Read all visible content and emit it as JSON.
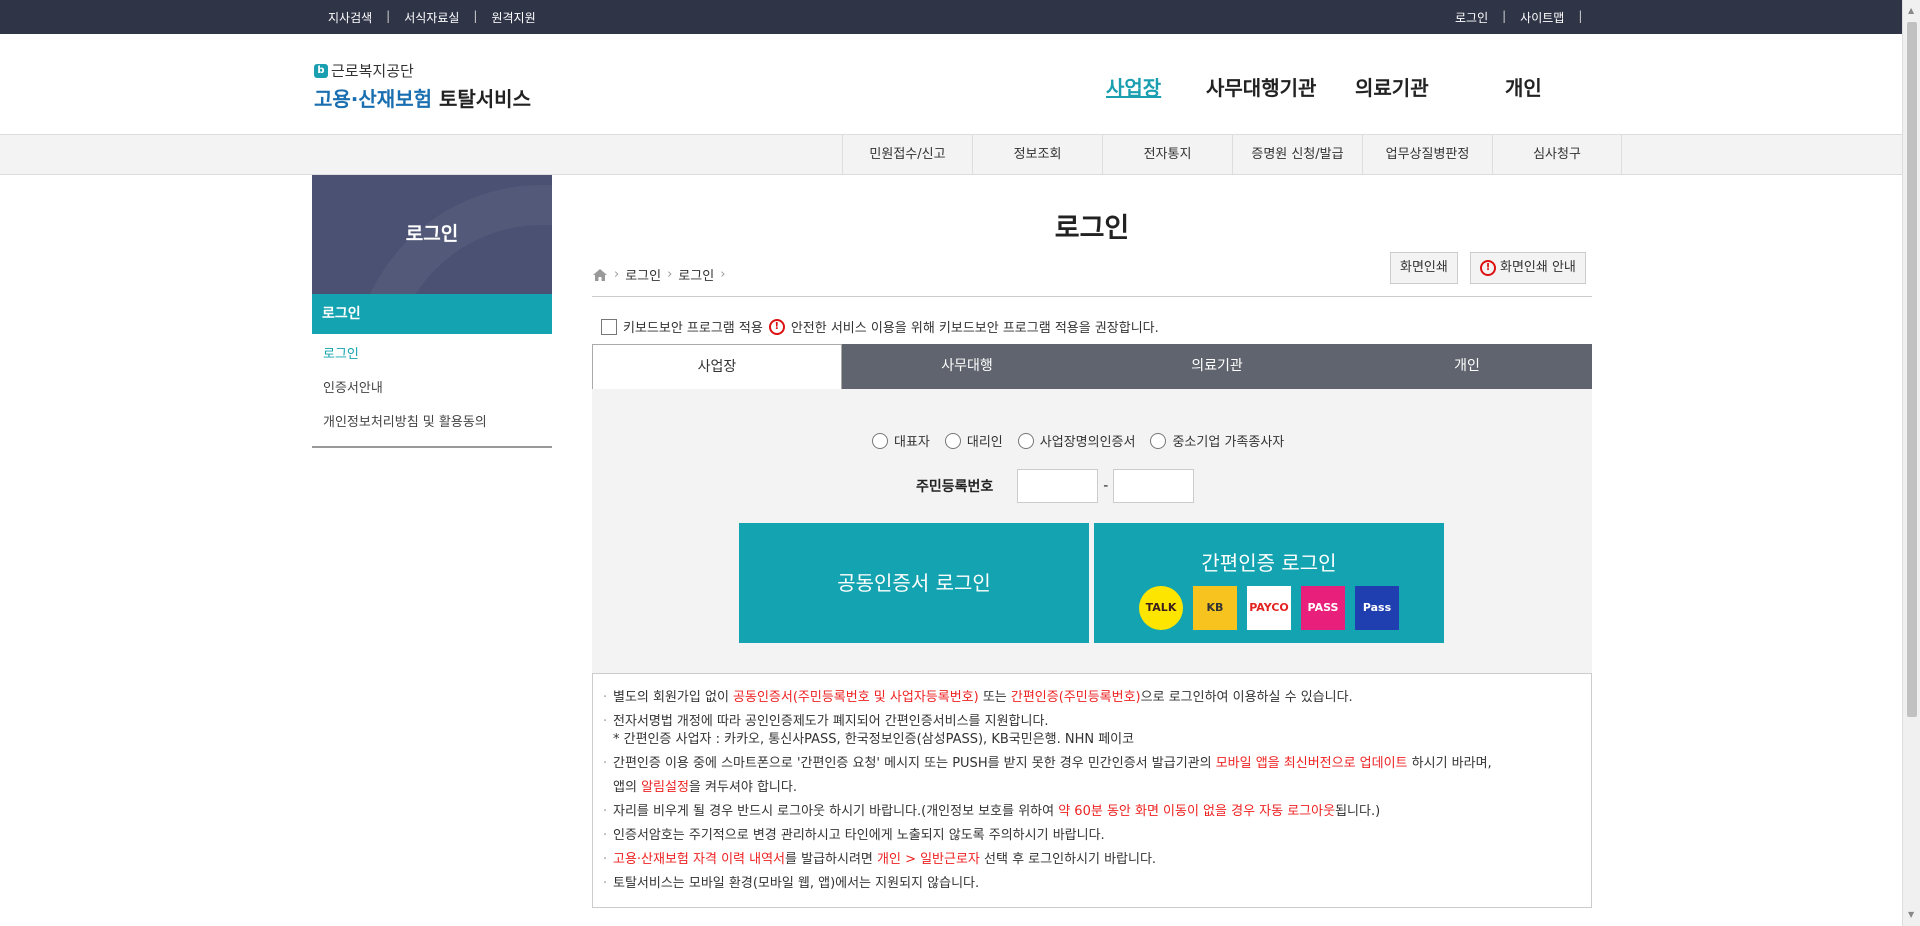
{
  "topbar": {
    "left": [
      "지사검색",
      "서식자료실",
      "원격지원"
    ],
    "right": [
      "로그인",
      "사이트맵"
    ],
    "sep": "|"
  },
  "logo": {
    "agency": "근로복지공단",
    "service_prefix": "고용·산재보험",
    "service_suffix": "토탈서비스"
  },
  "gnb": [
    "사업장",
    "사무대행기관",
    "의료기관",
    "개인"
  ],
  "subnav": [
    "민원접수/신고",
    "정보조회",
    "전자통지",
    "증명원 신청/발급",
    "업무상질병판정",
    "심사청구"
  ],
  "lnb": {
    "title": "로그인",
    "active": "로그인",
    "items": [
      "로그인",
      "인증서안내",
      "개인정보처리방침 및 활용동의"
    ]
  },
  "page": {
    "title": "로그인",
    "breadcrumb": [
      "로그인",
      "로그인"
    ],
    "print_btn": "화면인쇄",
    "print_guide_btn": "화면인쇄 안내"
  },
  "keyboard": {
    "label": "키보드보안 프로그램 적용",
    "notice": "안전한 서비스 이용을 위해 키보드보안 프로그램 적용을 권장합니다."
  },
  "tabs": [
    "사업장",
    "사무대행",
    "의료기관",
    "개인"
  ],
  "radios": [
    "대표자",
    "대리인",
    "사업장명의인증서",
    "중소기업 가족종사자"
  ],
  "rrn_label": "주민등록번호",
  "rrn_dash": "-",
  "cert_login": "공동인증서 로그인",
  "simple_login": "간편인증 로그인",
  "apps": [
    {
      "name": "TALK",
      "bg": "#fee500",
      "fg": "#3b1e1e"
    },
    {
      "name": "KB",
      "bg": "#f7c41f",
      "fg": "#333"
    },
    {
      "name": "PAYCO",
      "bg": "#ffffff",
      "fg": "#e3231f"
    },
    {
      "name": "PASS",
      "bg": "#e8207c",
      "fg": "#ffffff"
    },
    {
      "name": "Pass",
      "bg": "#1f3fb0",
      "fg": "#ffffff"
    }
  ],
  "notes": {
    "n1a": "별도의 회원가입 없이 ",
    "n1b": "공동인증서(주민등록번호 및 사업자등록번호)",
    "n1c": " 또는 ",
    "n1d": "간편인증(주민등록번호)",
    "n1e": "으로 로그인하여 이용하실 수 있습니다.",
    "n2": "전자서명법 개정에 따라 공인인증제도가 폐지되어 간편인증서비스를 지원합니다.",
    "n2sub": "* 간편인증 사업자 : 카카오, 통신사PASS, 한국정보인증(삼성PASS), KB국민은행. NHN 페이코",
    "n3a": "간편인증 이용 중에 스마트폰으로 '간편인증 요청' 메시지 또는 PUSH를 받지 못한 경우 민간인증서 발급기관의 ",
    "n3b": "모바일 앱을 최신버전으로 업데이트",
    "n3c": " 하시기 바라며,",
    "n3d": "앱의 ",
    "n3e": "알림설정",
    "n3f": "을 켜두셔야 합니다.",
    "n4a": "자리를 비우게 될 경우 반드시 로그아웃 하시기 바랍니다.(개인정보 보호를 위하여 ",
    "n4b": "약 60분 동안 화면 이동이 없을 경우 자동 로그아웃",
    "n4c": "됩니다.)",
    "n5": "인증서암호는 주기적으로 변경 관리하시고 타인에게 노출되지 않도록 주의하시기 바랍니다.",
    "n6a": "고용·산재보험 자격 이력 내역서",
    "n6b": "를 발급하시려면 ",
    "n6c": "개인 > 일반근로자",
    "n6d": " 선택 후 로그인하시기 바랍니다.",
    "n7": "토탈서비스는 모바일 환경(모바일 웹, 앱)에서는 지원되지 않습니다."
  }
}
